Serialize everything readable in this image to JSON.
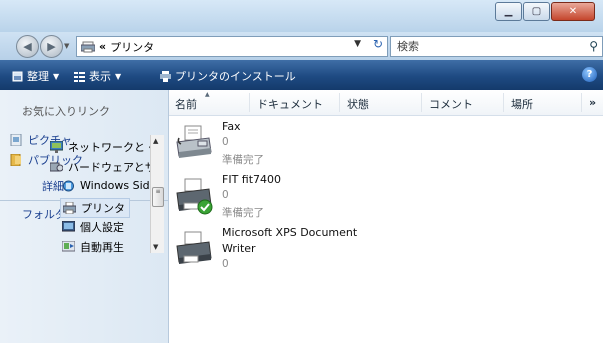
{
  "address": {
    "breadcrumb_chevron": "«",
    "path": "プリンタ"
  },
  "search": {
    "placeholder": "検索"
  },
  "toolbar": {
    "organize": "整理",
    "views": "表示",
    "install_printer": "プリンタのインストール",
    "help": "?"
  },
  "sidebar": {
    "favorites_title": "お気に入りリンク",
    "favorites": [
      {
        "label": "ピクチャ"
      },
      {
        "label": "パブリック"
      }
    ],
    "more": "詳細 »",
    "folders_title": "フォルダ",
    "tree": [
      {
        "label": "ネットワークと・"
      },
      {
        "label": "ハードウェアとサ"
      },
      {
        "label": "Windows Side"
      },
      {
        "label": "プリンタ"
      },
      {
        "label": "個人設定"
      },
      {
        "label": "自動再生"
      }
    ]
  },
  "columns": [
    "名前",
    "ドキュメント",
    "状態",
    "コメント",
    "場所",
    "»"
  ],
  "printers": [
    {
      "name": "Fax",
      "documents": "0",
      "status": "準備完了"
    },
    {
      "name": "FIT fit7400",
      "documents": "0",
      "status": "準備完了"
    },
    {
      "name_line1": "Microsoft XPS Document",
      "name_line2": "Writer",
      "documents": "0"
    }
  ],
  "colors": {
    "toolbar": "#1e4a82",
    "link": "#1a3f8f",
    "muted": "#8a8a8a"
  }
}
